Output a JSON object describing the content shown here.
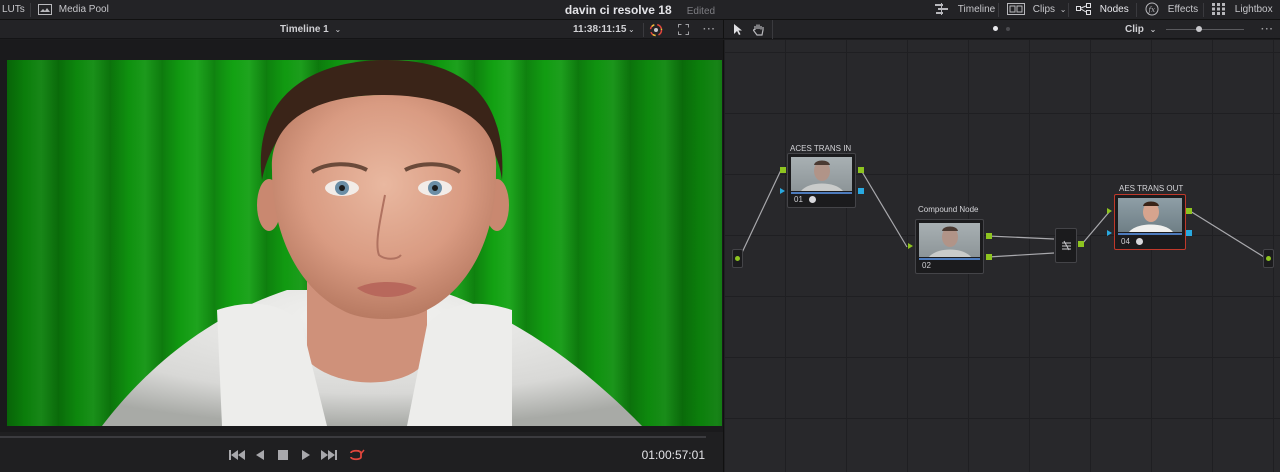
{
  "topbar": {
    "luts_label": "LUTs",
    "media_pool_label": "Media Pool",
    "project_title": "davin ci resolve 18",
    "project_status": "Edited",
    "timeline_label": "Timeline",
    "clips_label": "Clips",
    "nodes_label": "Nodes",
    "effects_label": "Effects",
    "lightbox_label": "Lightbox"
  },
  "viewer": {
    "timeline_name": "Timeline 1",
    "source_timecode": "11:38:11:15",
    "record_timecode": "01:00:57:01"
  },
  "node_editor": {
    "mode": "Clip",
    "nodes": [
      {
        "label": "ACES TRANS IN",
        "number": "01"
      },
      {
        "label": "Compound Node",
        "number": "02"
      },
      {
        "label": "AES TRANS OUT",
        "number": "04"
      }
    ]
  },
  "colors": {
    "accent_green": "#8ec420",
    "accent_blue": "#29a9e0",
    "selected_red": "#c0392b",
    "loop_red": "#e0463c"
  }
}
